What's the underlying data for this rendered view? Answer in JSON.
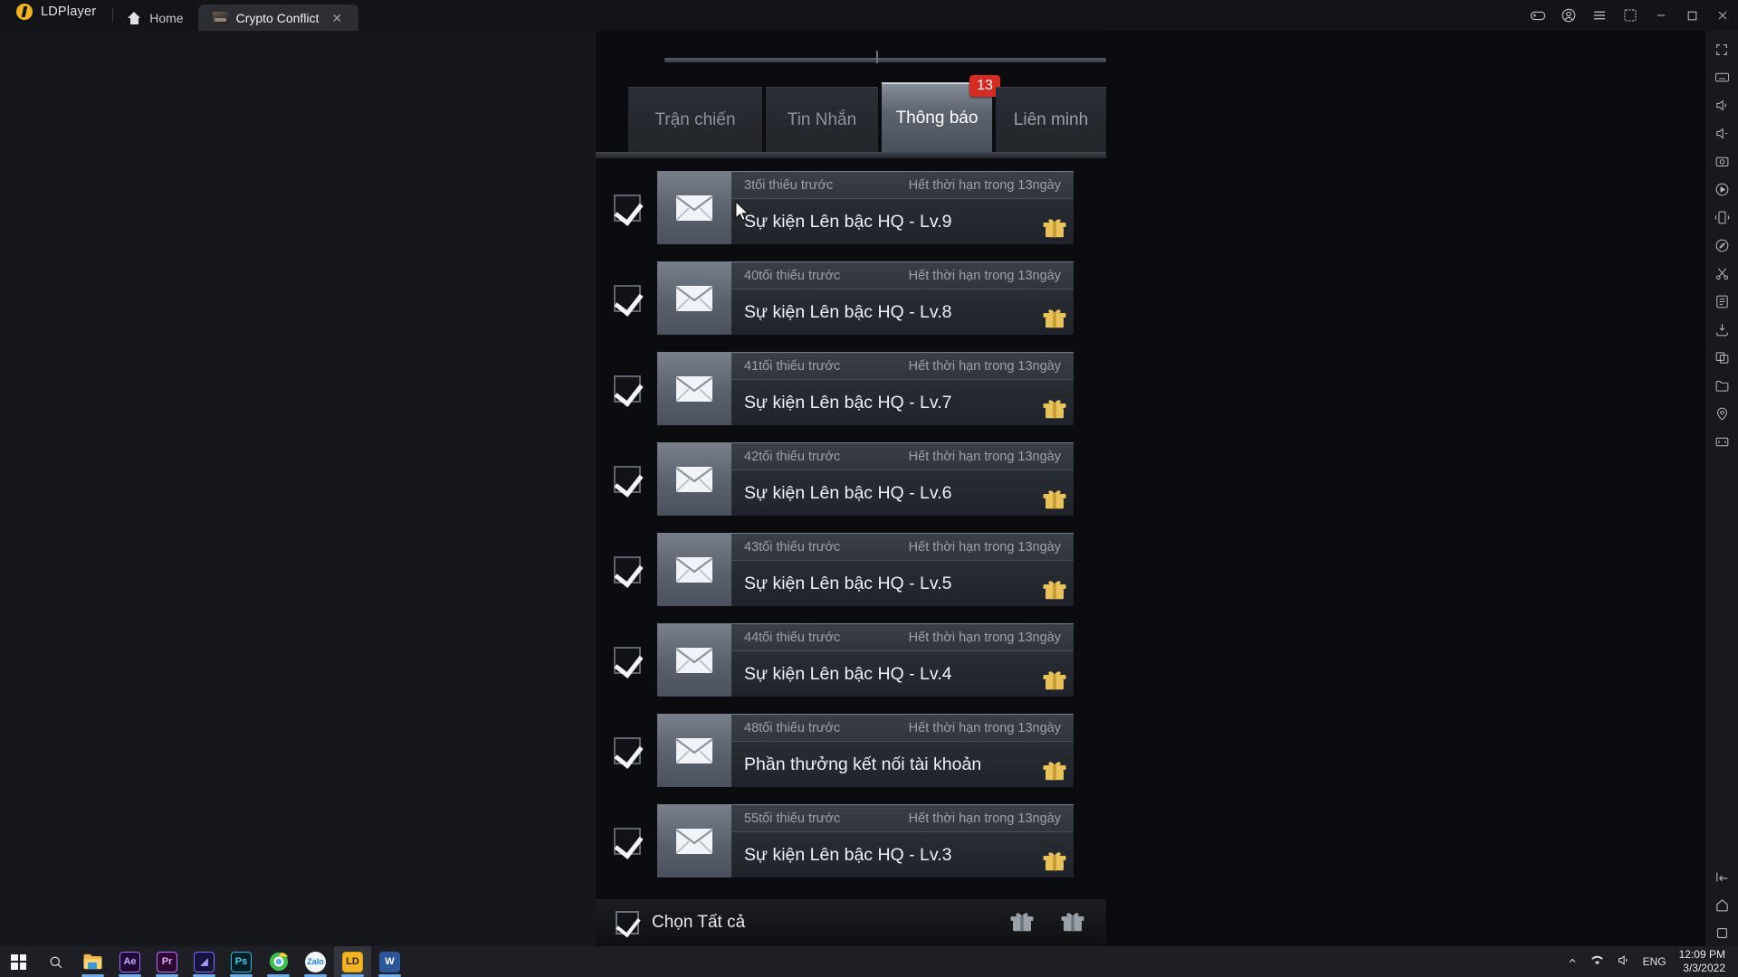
{
  "app": {
    "brand": "LDPlayer",
    "brand_logo_icon": "ldplayer-logo-icon",
    "tabs": [
      {
        "label": "Home",
        "icon": "home-icon",
        "active": false
      },
      {
        "label": "Crypto Conflict",
        "icon": "game-thumbnail-icon",
        "active": true,
        "close_icon": "close-icon"
      }
    ],
    "window_controls": [
      {
        "name": "gamepad-icon"
      },
      {
        "name": "account-icon"
      },
      {
        "name": "menu-icon"
      },
      {
        "name": "multi-instance-icon"
      },
      {
        "name": "minimize-icon"
      },
      {
        "name": "maximize-icon"
      },
      {
        "name": "close-icon"
      }
    ]
  },
  "rail": {
    "items": [
      "fullscreen-icon",
      "keyboard-icon",
      "volume-up-icon",
      "volume-down-icon",
      "screenshot-icon",
      "video-record-icon",
      "shake-icon",
      "location-route-icon",
      "scissors-icon",
      "script-icon",
      "apk-install-icon",
      "multi-window-icon",
      "folder-icon",
      "gps-location-icon",
      "rotate-screen-icon"
    ],
    "bottom_items": [
      "back-icon",
      "home-nav-icon",
      "recents-icon"
    ]
  },
  "game": {
    "tabs": [
      {
        "label": "Trận chiến",
        "active": false,
        "badge": null
      },
      {
        "label": "Tin Nhắn",
        "active": false,
        "badge": null
      },
      {
        "label": "Thông báo",
        "active": true,
        "badge": "13"
      },
      {
        "label": "Liên minh",
        "active": false,
        "badge": null
      }
    ],
    "mail_rows": [
      {
        "time": "3tối thiếu trước",
        "expiry": "Hết thời hạn trong 13ngày",
        "title": "Sự kiện Lên bậc HQ - Lv.9",
        "checked": true,
        "mail_icon": "envelope-icon",
        "reward_icon": "gift-icon"
      },
      {
        "time": "40tối thiếu trước",
        "expiry": "Hết thời hạn trong 13ngày",
        "title": "Sự kiện Lên bậc HQ - Lv.8",
        "checked": true,
        "mail_icon": "envelope-icon",
        "reward_icon": "gift-icon"
      },
      {
        "time": "41tối thiếu trước",
        "expiry": "Hết thời hạn trong 13ngày",
        "title": "Sự kiện Lên bậc HQ - Lv.7",
        "checked": true,
        "mail_icon": "envelope-icon",
        "reward_icon": "gift-icon"
      },
      {
        "time": "42tối thiếu trước",
        "expiry": "Hết thời hạn trong 13ngày",
        "title": "Sự kiện Lên bậc HQ - Lv.6",
        "checked": true,
        "mail_icon": "envelope-icon",
        "reward_icon": "gift-icon"
      },
      {
        "time": "43tối thiếu trước",
        "expiry": "Hết thời hạn trong 13ngày",
        "title": "Sự kiện Lên bậc HQ - Lv.5",
        "checked": true,
        "mail_icon": "envelope-icon",
        "reward_icon": "gift-icon"
      },
      {
        "time": "44tối thiếu trước",
        "expiry": "Hết thời hạn trong 13ngày",
        "title": "Sự kiện Lên bậc HQ - Lv.4",
        "checked": true,
        "mail_icon": "envelope-icon",
        "reward_icon": "gift-icon"
      },
      {
        "time": "48tối thiếu trước",
        "expiry": "Hết thời hạn trong 13ngày",
        "title": "Phần thưởng kết nối tài khoản",
        "checked": true,
        "mail_icon": "envelope-icon",
        "reward_icon": "gift-icon"
      },
      {
        "time": "55tối thiếu trước",
        "expiry": "Hết thời hạn trong 13ngày",
        "title": "Sự kiện Lên bậc HQ - Lv.3",
        "checked": true,
        "mail_icon": "envelope-icon",
        "reward_icon": "gift-icon"
      }
    ],
    "footer": {
      "select_all_label": "Chọn Tất cả",
      "checked": true,
      "actions": [
        "claim-all-gift-icon",
        "delete-gift-icon"
      ]
    }
  },
  "taskbar": {
    "items": [
      {
        "name": "start-button",
        "icon": "windows-logo-icon",
        "label": ""
      },
      {
        "name": "search-button",
        "icon": "search-icon",
        "label": ""
      },
      {
        "name": "file-explorer-button",
        "icon": "folder-icon",
        "label": ""
      },
      {
        "name": "after-effects-button",
        "icon": "after-effects-icon",
        "label": "Ae",
        "color": "#c1a0ff",
        "bg": "#1f0a33"
      },
      {
        "name": "premiere-pro-button",
        "icon": "premiere-pro-icon",
        "label": "Pr",
        "color": "#eaa0ff",
        "bg": "#2a0a33"
      },
      {
        "name": "media-encoder-button",
        "icon": "media-encoder-icon",
        "label": "",
        "color": "#a89bff",
        "bg": "#15133a"
      },
      {
        "name": "photoshop-button",
        "icon": "photoshop-icon",
        "label": "Ps",
        "color": "#36c5f0",
        "bg": "#001e26"
      },
      {
        "name": "chrome-button",
        "icon": "browser-icon",
        "label": ""
      },
      {
        "name": "zalo-button",
        "icon": "zalo-icon",
        "label": "Zalo"
      },
      {
        "name": "ldplayer-button",
        "icon": "ldplayer-taskbar-icon",
        "label": "LD"
      },
      {
        "name": "word-button",
        "icon": "word-icon",
        "label": "W"
      }
    ],
    "tray": {
      "chevron_icon": "show-hidden-icons-icon",
      "network_icon": "network-icon",
      "volume_icon": "volume-icon",
      "language": "ENG",
      "time": "12:09 PM",
      "date": "3/3/2022"
    }
  }
}
